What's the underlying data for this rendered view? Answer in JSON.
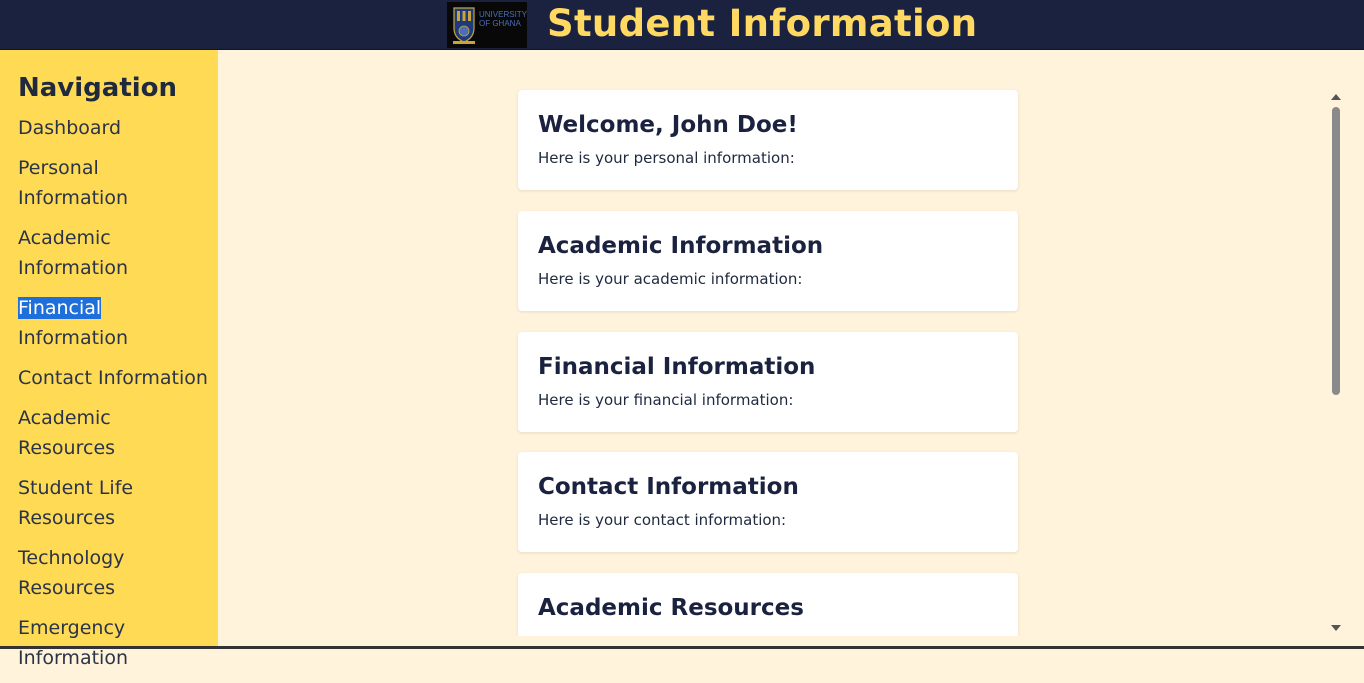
{
  "header": {
    "logo_text": "University of Ghana",
    "title": "Student Information"
  },
  "sidebar": {
    "heading": "Navigation",
    "items": [
      {
        "label": "Dashboard"
      },
      {
        "label": "Personal Information"
      },
      {
        "label": "Academic Information"
      },
      {
        "label_selected": "Financial",
        "label_rest": " Information"
      },
      {
        "label": "Contact Information"
      },
      {
        "label": "Academic Resources"
      },
      {
        "label": "Student Life Resources"
      },
      {
        "label": "Technology Resources"
      },
      {
        "label": "Emergency Information"
      }
    ]
  },
  "main": {
    "cards": [
      {
        "title": "Welcome, John Doe!",
        "text": "Here is your personal information:"
      },
      {
        "title": "Academic Information",
        "text": "Here is your academic information:"
      },
      {
        "title": "Financial Information",
        "text": "Here is your financial information:"
      },
      {
        "title": "Contact Information",
        "text": "Here is your contact information:"
      },
      {
        "title": "Academic Resources",
        "text": ""
      }
    ]
  },
  "colors": {
    "header_bg": "#1B2240",
    "title": "#FFD961",
    "sidebar_bg": "#FFDA55",
    "content_bg": "#FFF3DC",
    "selection": "#1E6FD9"
  }
}
